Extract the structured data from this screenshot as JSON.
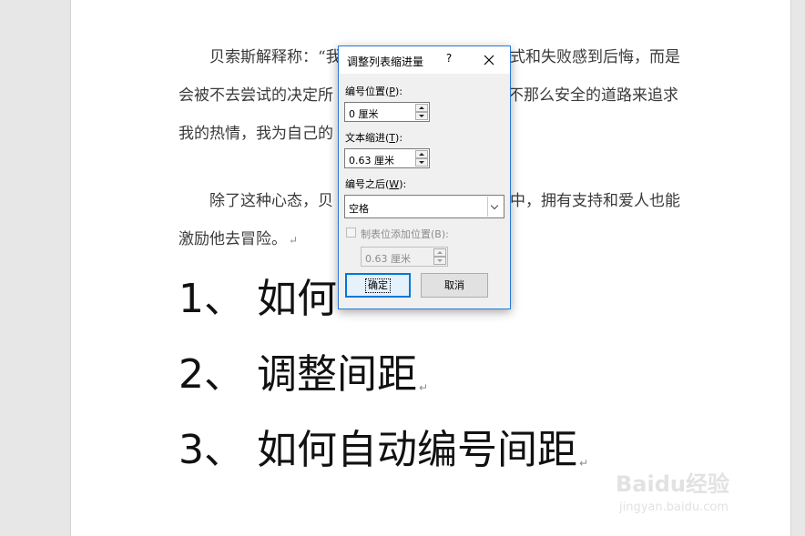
{
  "document": {
    "paragraph1": {
      "line1_before": "贝索斯解释称：“我",
      "line1_squiggle": "",
      "line1_after": "式和失败感到后悔，而是",
      "line2_left": "会被不去尝试的决定所",
      "line2_right": "不那么安全的道路来追求",
      "line3_left": "我的热情，我为自己的"
    },
    "paragraph2": {
      "line1_left": "除了这种心态，贝",
      "line1_right": "中，拥有支持和爱人也能",
      "line2": "激励他去冒险。"
    },
    "list": [
      {
        "number": "1、",
        "text": "如何"
      },
      {
        "number": "2、",
        "text": "调整间距"
      },
      {
        "number": "3、",
        "text": "如何自动编号间距"
      }
    ],
    "paragraph_mark": "↵"
  },
  "dialog": {
    "title": "调整列表缩进量",
    "help": "?",
    "number_position_label": "编号位置(",
    "number_position_key": "P",
    "number_position_label_end": "):",
    "number_position_value": "0 厘米",
    "text_indent_label": "文本缩进(",
    "text_indent_key": "T",
    "text_indent_label_end": "):",
    "text_indent_value": "0.63 厘米",
    "follow_number_label": "编号之后(",
    "follow_number_key": "W",
    "follow_number_label_end": "):",
    "follow_number_value": "空格",
    "tab_stop_label": "制表位添加位置(B):",
    "tab_stop_value": "0.63 厘米",
    "ok_label": "确定",
    "cancel_label": "取消"
  },
  "watermark": {
    "brand": "Baidu经验",
    "url": "jingyan.baidu.com"
  },
  "colors": {
    "dialog_border": "#2b78d6",
    "ok_button_border": "#0078d7",
    "page_background": "#e7e7e7"
  }
}
